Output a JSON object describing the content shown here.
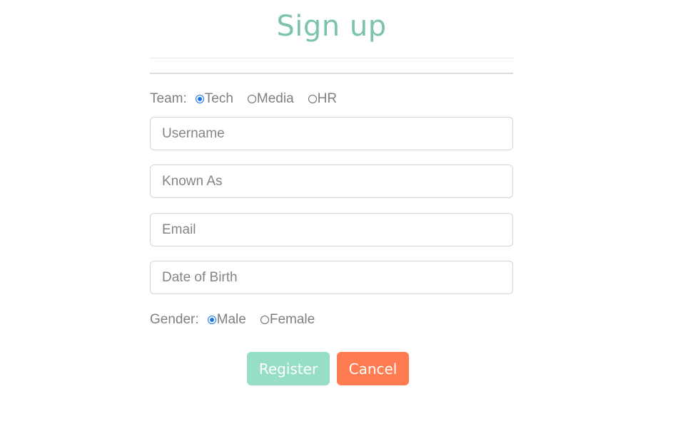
{
  "page": {
    "title": "Sign up"
  },
  "colors": {
    "title": "#7cc4a8",
    "radio_checked": "#1a73e8",
    "register_button": "#96dfc4",
    "cancel_button": "#ff7b52"
  },
  "team": {
    "label": "Team:",
    "options": [
      {
        "label": "Tech",
        "checked": true
      },
      {
        "label": "Media",
        "checked": false
      },
      {
        "label": "HR",
        "checked": false
      }
    ]
  },
  "fields": {
    "username": {
      "placeholder": "Username",
      "value": ""
    },
    "known_as": {
      "placeholder": "Known As",
      "value": ""
    },
    "email": {
      "placeholder": "Email",
      "value": ""
    },
    "date_of_birth": {
      "placeholder": "Date of Birth",
      "value": ""
    }
  },
  "gender": {
    "label": "Gender:",
    "options": [
      {
        "label": "Male",
        "checked": true
      },
      {
        "label": "Female",
        "checked": false
      }
    ]
  },
  "buttons": {
    "register_label": "Register",
    "cancel_label": "Cancel"
  }
}
